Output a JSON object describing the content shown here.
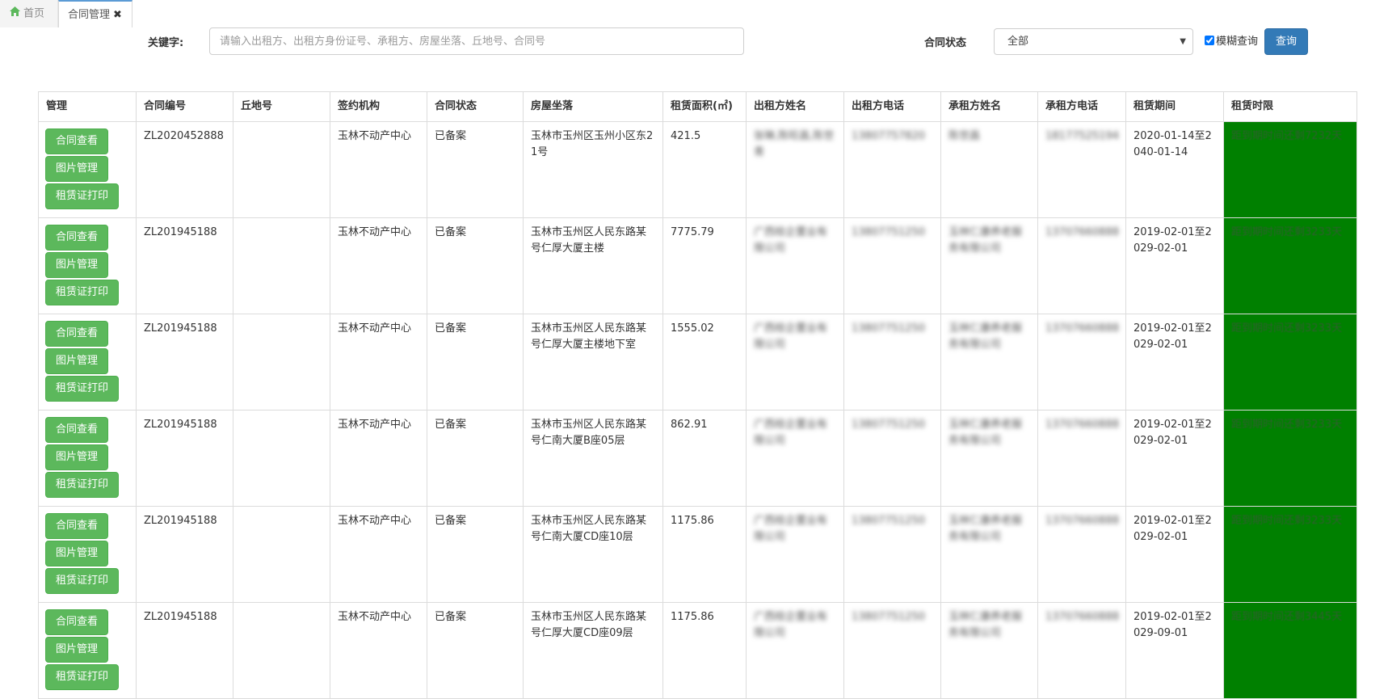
{
  "tabs": {
    "home_label": "首页",
    "active_label": "合同管理",
    "close_glyph": "✖"
  },
  "search": {
    "keyword_label": "关键字:",
    "keyword_placeholder": "请输入出租方、出租方身份证号、承租方、房屋坐落、丘地号、合同号",
    "status_label": "合同状态",
    "status_value": "全部",
    "fuzzy_label": "模糊查询",
    "fuzzy_checked": true,
    "query_button": "查询"
  },
  "table": {
    "headers": [
      "管理",
      "合同编号",
      "丘地号",
      "签约机构",
      "合同状态",
      "房屋坐落",
      "租赁面积(㎡)",
      "出租方姓名",
      "出租方电话",
      "承租方姓名",
      "承租方电话",
      "租赁期间",
      "租赁时限"
    ],
    "action_labels": [
      "合同查看",
      "图片管理",
      "租赁证打印"
    ],
    "rows": [
      {
        "contract_no": "ZL2020452888",
        "parcel": "",
        "org": "玉林不动产中心",
        "status": "已备案",
        "location": "玉林市玉州区玉州小区东21号",
        "area": "421.5",
        "lessor": "张琳,陈旺昌,陈世青",
        "lessor_phone": "13807757820",
        "lessee": "陈世昌",
        "lessee_phone": "18177525194",
        "period": "2020-01-14至2040-01-14",
        "term": "距到期时间还剩7232天"
      },
      {
        "contract_no": "ZL201945188",
        "parcel": "",
        "org": "玉林不动产中心",
        "status": "已备案",
        "location": "玉林市玉州区人民东路某号仁厚大厦主楼",
        "area": "7775.79",
        "lessor": "广西桂企置业有限公司",
        "lessor_phone": "13807751250",
        "lessee": "玉林仁康养老服务有限公司",
        "lessee_phone": "13707660888",
        "period": "2019-02-01至2029-02-01",
        "term": "距到期时间还剩3233天"
      },
      {
        "contract_no": "ZL201945188",
        "parcel": "",
        "org": "玉林不动产中心",
        "status": "已备案",
        "location": "玉林市玉州区人民东路某号仁厚大厦主楼地下室",
        "area": "1555.02",
        "lessor": "广西桂企置业有限公司",
        "lessor_phone": "13807751250",
        "lessee": "玉林仁康养老服务有限公司",
        "lessee_phone": "13707660888",
        "period": "2019-02-01至2029-02-01",
        "term": "距到期时间还剩3233天"
      },
      {
        "contract_no": "ZL201945188",
        "parcel": "",
        "org": "玉林不动产中心",
        "status": "已备案",
        "location": "玉林市玉州区人民东路某号仁南大厦B座05层",
        "area": "862.91",
        "lessor": "广西桂企置业有限公司",
        "lessor_phone": "13807751250",
        "lessee": "玉林仁康养老服务有限公司",
        "lessee_phone": "13707660888",
        "period": "2019-02-01至2029-02-01",
        "term": "距到期时间还剩3233天"
      },
      {
        "contract_no": "ZL201945188",
        "parcel": "",
        "org": "玉林不动产中心",
        "status": "已备案",
        "location": "玉林市玉州区人民东路某号仁南大厦CD座10层",
        "area": "1175.86",
        "lessor": "广西桂企置业有限公司",
        "lessor_phone": "13807751250",
        "lessee": "玉林仁康养老服务有限公司",
        "lessee_phone": "13707660888",
        "period": "2019-02-01至2029-02-01",
        "term": "距到期时间还剩3233天"
      },
      {
        "contract_no": "ZL201945188",
        "parcel": "",
        "org": "玉林不动产中心",
        "status": "已备案",
        "location": "玉林市玉州区人民东路某号仁厚大厦CD座09层",
        "area": "1175.86",
        "lessor": "广西桂企置业有限公司",
        "lessor_phone": "13807751250",
        "lessee": "玉林仁康养老服务有限公司",
        "lessee_phone": "13707660888",
        "period": "2019-02-01至2029-09-01",
        "term": "距到期时间还剩3445天"
      }
    ]
  },
  "colors": {
    "primary": "#337ab7",
    "success": "#5cb85c",
    "term_bg": "#008000",
    "home_icon": "#5cb85c"
  }
}
